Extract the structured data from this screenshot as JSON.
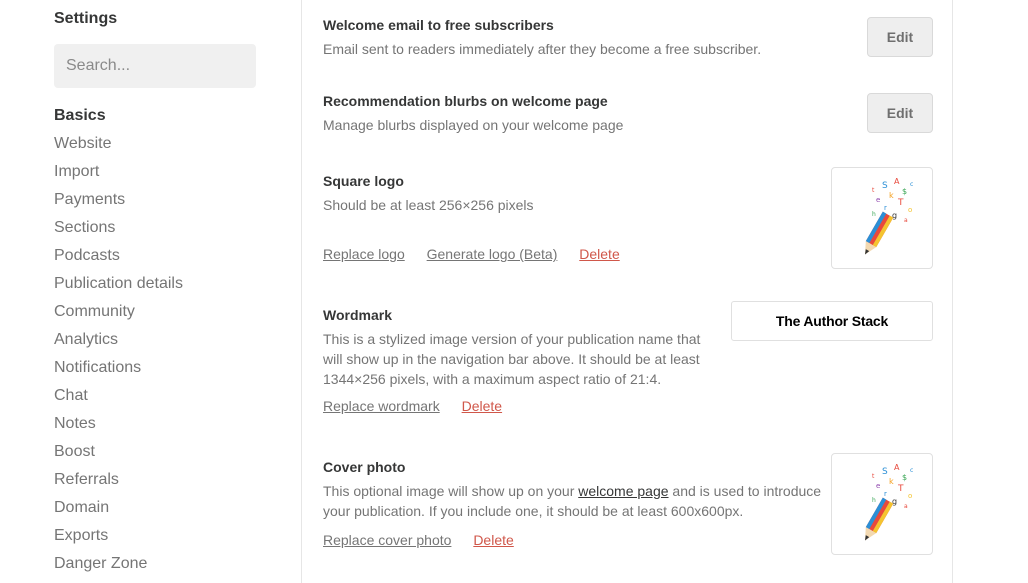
{
  "sidebar": {
    "title": "Settings",
    "search_placeholder": "Search...",
    "items": [
      {
        "label": "Basics",
        "active": true
      },
      {
        "label": "Website"
      },
      {
        "label": "Import"
      },
      {
        "label": "Payments"
      },
      {
        "label": "Sections"
      },
      {
        "label": "Podcasts"
      },
      {
        "label": "Publication details"
      },
      {
        "label": "Community"
      },
      {
        "label": "Analytics"
      },
      {
        "label": "Notifications"
      },
      {
        "label": "Chat"
      },
      {
        "label": "Notes"
      },
      {
        "label": "Boost"
      },
      {
        "label": "Referrals"
      },
      {
        "label": "Domain"
      },
      {
        "label": "Exports"
      },
      {
        "label": "Danger Zone"
      }
    ]
  },
  "settings": {
    "welcome_email": {
      "title": "Welcome email to free subscribers",
      "description": "Email sent to readers immediately after they become a free subscriber.",
      "button": "Edit"
    },
    "blurbs": {
      "title": "Recommendation blurbs on welcome page",
      "description": "Manage blurbs displayed on your welcome page",
      "button": "Edit"
    },
    "square_logo": {
      "title": "Square logo",
      "description": "Should be at least 256×256 pixels",
      "replace": "Replace logo",
      "generate": "Generate logo (Beta)",
      "delete": "Delete"
    },
    "wordmark": {
      "title": "Wordmark",
      "description": "This is a stylized image version of your publication name that will show up in the navigation bar above. It should be at least 1344×256 pixels, with a maximum aspect ratio of 21:4.",
      "preview_text": "The Author Stack",
      "replace": "Replace wordmark",
      "delete": "Delete"
    },
    "cover_photo": {
      "desc_before": "This optional image will show up on your ",
      "desc_link": "welcome page",
      "desc_after": " and is used to introduce your publication. If you include one, it should be at least 600x600px.",
      "title": "Cover photo",
      "replace": "Replace cover photo",
      "delete": "Delete"
    }
  },
  "colors": {
    "danger": "#d0574a",
    "muted": "#757575",
    "text": "#363737"
  },
  "icons": {
    "logo": "pencil-letters-logo-icon"
  }
}
